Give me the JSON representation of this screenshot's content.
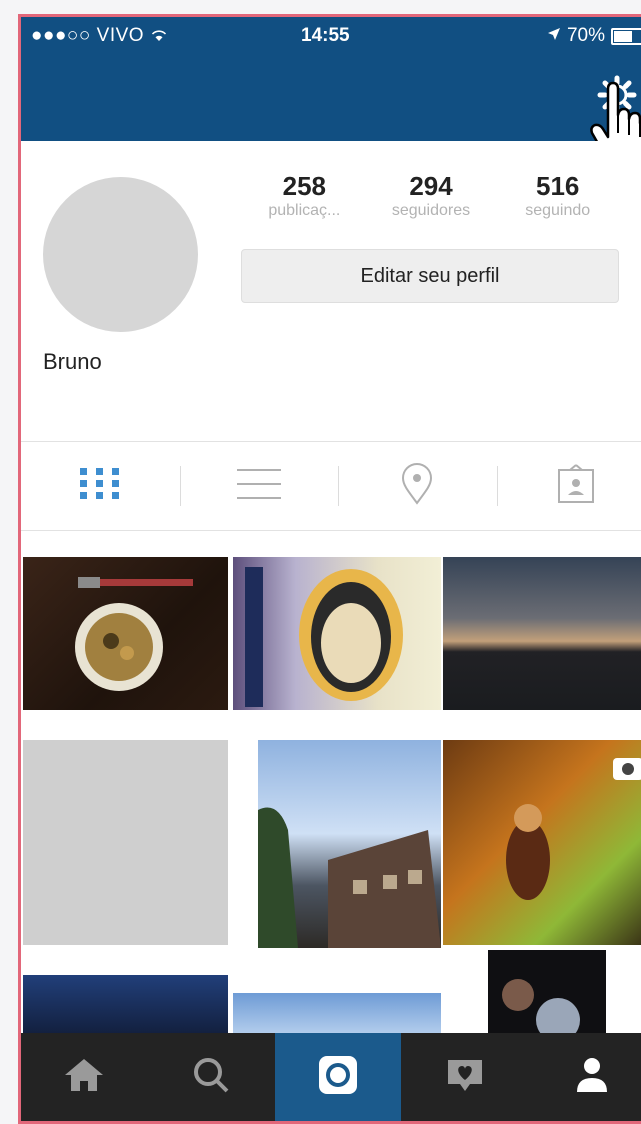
{
  "status_bar": {
    "carrier": "●●●○○ VIVO",
    "time": "14:55",
    "battery": "70%",
    "battery_level": 0.7
  },
  "profile": {
    "name": "Bruno",
    "edit_button": "Editar seu perfil",
    "stats": [
      {
        "value": "258",
        "label": "publicaç..."
      },
      {
        "value": "294",
        "label": "seguidores"
      },
      {
        "value": "516",
        "label": "seguindo"
      }
    ]
  },
  "view_tabs": [
    "grid-icon",
    "list-icon",
    "location-pin-icon",
    "tagged-photos-icon"
  ],
  "bottom_tabs": [
    "home-icon",
    "search-icon",
    "camera-icon",
    "activity-icon",
    "profile-icon"
  ],
  "colors": {
    "nav_blue": "#114f82",
    "active_tab_blue": "#1b5a8c",
    "tabbar_dark": "#232323",
    "grid_icon_blue": "#3e8ed0",
    "frame_pink": "#e2677a"
  }
}
